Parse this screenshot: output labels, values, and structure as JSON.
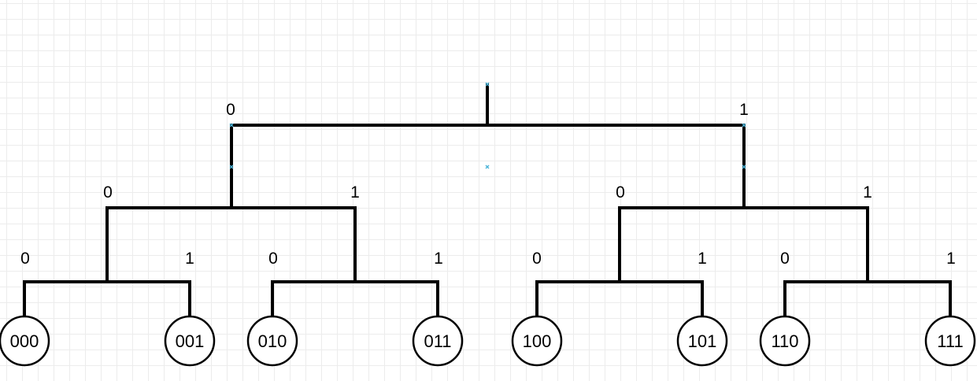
{
  "diagram": {
    "edge_labels": {
      "level1": {
        "left": "0",
        "right": "1"
      },
      "level2": [
        {
          "left": "0",
          "right": "1"
        },
        {
          "left": "0",
          "right": "1"
        }
      ],
      "level3": [
        {
          "left": "0",
          "right": "1"
        },
        {
          "left": "0",
          "right": "1"
        },
        {
          "left": "0",
          "right": "1"
        },
        {
          "left": "0",
          "right": "1"
        }
      ]
    },
    "leaves": [
      "000",
      "001",
      "010",
      "011",
      "100",
      "101",
      "110",
      "111"
    ],
    "colors": {
      "line": "#000000",
      "grid": "#ececec",
      "selection_handle": "#4ab3d8"
    }
  }
}
